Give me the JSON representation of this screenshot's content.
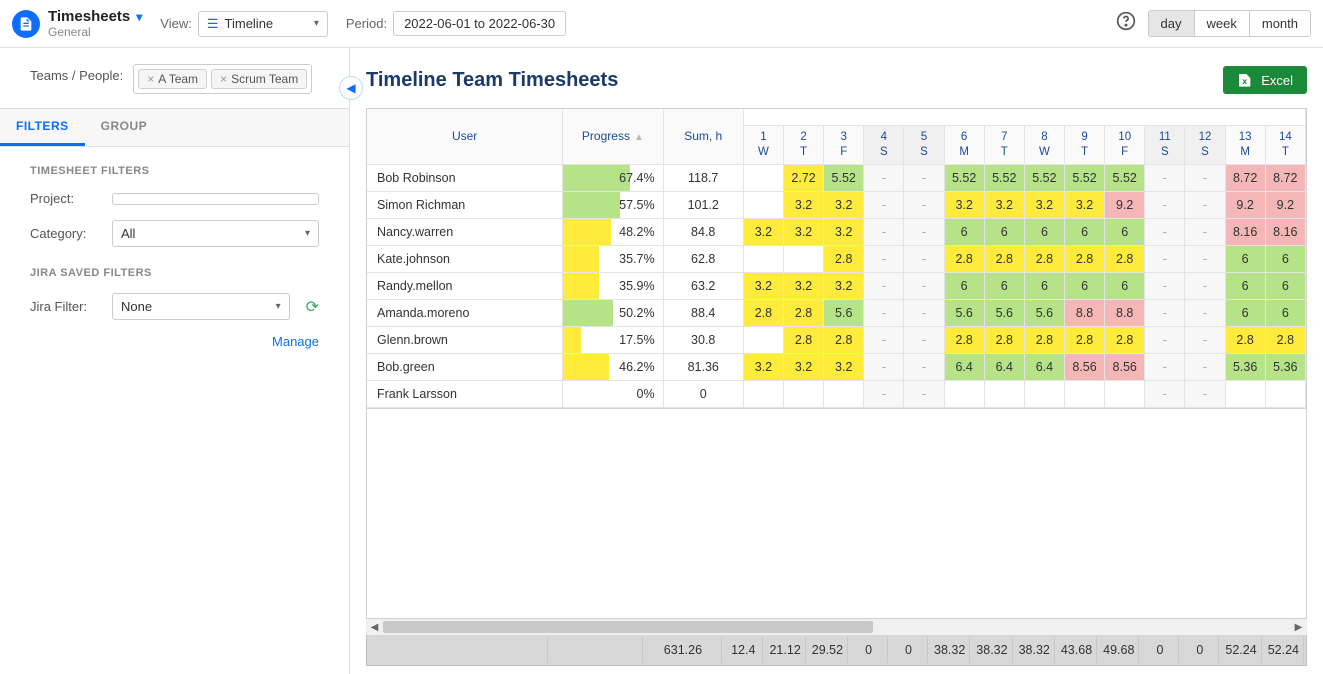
{
  "header": {
    "title": "Timesheets",
    "subtitle": "General",
    "view_label": "View:",
    "view_value": "Timeline",
    "period_label": "Period:",
    "period_value": "2022-06-01 to 2022-06-30",
    "ranges": {
      "day": "day",
      "week": "week",
      "month": "month"
    }
  },
  "sidebar": {
    "teams_label": "Teams / People:",
    "chip1": "A Team",
    "chip2": "Scrum Team",
    "tab_filters": "FILTERS",
    "tab_group": "GROUP",
    "sect_timesheet": "TIMESHEET FILTERS",
    "project_label": "Project:",
    "category_label": "Category:",
    "category_value": "All",
    "sect_jira": "JIRA SAVED FILTERS",
    "jira_label": "Jira Filter:",
    "jira_value": "None",
    "manage": "Manage"
  },
  "main": {
    "title": "Timeline Team Timesheets",
    "excel": "Excel"
  },
  "cols": {
    "user": "User",
    "progress": "Progress",
    "sum": "Sum, h",
    "days": [
      {
        "n": "1",
        "d": "W",
        "we": false
      },
      {
        "n": "2",
        "d": "T",
        "we": false
      },
      {
        "n": "3",
        "d": "F",
        "we": false
      },
      {
        "n": "4",
        "d": "S",
        "we": true
      },
      {
        "n": "5",
        "d": "S",
        "we": true
      },
      {
        "n": "6",
        "d": "M",
        "we": false
      },
      {
        "n": "7",
        "d": "T",
        "we": false
      },
      {
        "n": "8",
        "d": "W",
        "we": false
      },
      {
        "n": "9",
        "d": "T",
        "we": false
      },
      {
        "n": "10",
        "d": "F",
        "we": false
      },
      {
        "n": "11",
        "d": "S",
        "we": true
      },
      {
        "n": "12",
        "d": "S",
        "we": true
      },
      {
        "n": "13",
        "d": "M",
        "we": false
      },
      {
        "n": "14",
        "d": "T",
        "we": false
      }
    ]
  },
  "rows": [
    {
      "user": "Bob Robinson",
      "progress": "67.4%",
      "pw": 67.4,
      "pb": "green",
      "sum": "118.7",
      "cells": [
        {
          "v": "",
          "c": ""
        },
        {
          "v": "2.72",
          "c": "c-yellow"
        },
        {
          "v": "5.52",
          "c": "c-green"
        },
        {
          "v": "-",
          "c": "dash weekend"
        },
        {
          "v": "-",
          "c": "dash weekend"
        },
        {
          "v": "5.52",
          "c": "c-green"
        },
        {
          "v": "5.52",
          "c": "c-green"
        },
        {
          "v": "5.52",
          "c": "c-green"
        },
        {
          "v": "5.52",
          "c": "c-green"
        },
        {
          "v": "5.52",
          "c": "c-green"
        },
        {
          "v": "-",
          "c": "dash weekend"
        },
        {
          "v": "-",
          "c": "dash weekend"
        },
        {
          "v": "8.72",
          "c": "c-red"
        },
        {
          "v": "8.72",
          "c": "c-red"
        }
      ]
    },
    {
      "user": "Simon Richman",
      "progress": "57.5%",
      "pw": 57.5,
      "pb": "green",
      "sum": "101.2",
      "cells": [
        {
          "v": "",
          "c": ""
        },
        {
          "v": "3.2",
          "c": "c-yellow"
        },
        {
          "v": "3.2",
          "c": "c-yellow"
        },
        {
          "v": "-",
          "c": "dash weekend"
        },
        {
          "v": "-",
          "c": "dash weekend"
        },
        {
          "v": "3.2",
          "c": "c-yellow"
        },
        {
          "v": "3.2",
          "c": "c-yellow"
        },
        {
          "v": "3.2",
          "c": "c-yellow"
        },
        {
          "v": "3.2",
          "c": "c-yellow"
        },
        {
          "v": "9.2",
          "c": "c-red"
        },
        {
          "v": "-",
          "c": "dash weekend"
        },
        {
          "v": "-",
          "c": "dash weekend"
        },
        {
          "v": "9.2",
          "c": "c-red"
        },
        {
          "v": "9.2",
          "c": "c-red"
        }
      ]
    },
    {
      "user": "Nancy.warren",
      "progress": "48.2%",
      "pw": 48.2,
      "pb": "yellow",
      "sum": "84.8",
      "cells": [
        {
          "v": "3.2",
          "c": "c-yellow"
        },
        {
          "v": "3.2",
          "c": "c-yellow"
        },
        {
          "v": "3.2",
          "c": "c-yellow"
        },
        {
          "v": "-",
          "c": "dash weekend"
        },
        {
          "v": "-",
          "c": "dash weekend"
        },
        {
          "v": "6",
          "c": "c-green"
        },
        {
          "v": "6",
          "c": "c-green"
        },
        {
          "v": "6",
          "c": "c-green"
        },
        {
          "v": "6",
          "c": "c-green"
        },
        {
          "v": "6",
          "c": "c-green"
        },
        {
          "v": "-",
          "c": "dash weekend"
        },
        {
          "v": "-",
          "c": "dash weekend"
        },
        {
          "v": "8.16",
          "c": "c-red"
        },
        {
          "v": "8.16",
          "c": "c-red"
        }
      ]
    },
    {
      "user": "Kate.johnson",
      "progress": "35.7%",
      "pw": 35.7,
      "pb": "yellow",
      "sum": "62.8",
      "cells": [
        {
          "v": "",
          "c": ""
        },
        {
          "v": "",
          "c": ""
        },
        {
          "v": "2.8",
          "c": "c-yellow"
        },
        {
          "v": "-",
          "c": "dash weekend"
        },
        {
          "v": "-",
          "c": "dash weekend"
        },
        {
          "v": "2.8",
          "c": "c-yellow"
        },
        {
          "v": "2.8",
          "c": "c-yellow"
        },
        {
          "v": "2.8",
          "c": "c-yellow"
        },
        {
          "v": "2.8",
          "c": "c-yellow"
        },
        {
          "v": "2.8",
          "c": "c-yellow"
        },
        {
          "v": "-",
          "c": "dash weekend"
        },
        {
          "v": "-",
          "c": "dash weekend"
        },
        {
          "v": "6",
          "c": "c-green"
        },
        {
          "v": "6",
          "c": "c-green"
        }
      ]
    },
    {
      "user": "Randy.mellon",
      "progress": "35.9%",
      "pw": 35.9,
      "pb": "yellow",
      "sum": "63.2",
      "cells": [
        {
          "v": "3.2",
          "c": "c-yellow"
        },
        {
          "v": "3.2",
          "c": "c-yellow"
        },
        {
          "v": "3.2",
          "c": "c-yellow"
        },
        {
          "v": "-",
          "c": "dash weekend"
        },
        {
          "v": "-",
          "c": "dash weekend"
        },
        {
          "v": "6",
          "c": "c-green"
        },
        {
          "v": "6",
          "c": "c-green"
        },
        {
          "v": "6",
          "c": "c-green"
        },
        {
          "v": "6",
          "c": "c-green"
        },
        {
          "v": "6",
          "c": "c-green"
        },
        {
          "v": "-",
          "c": "dash weekend"
        },
        {
          "v": "-",
          "c": "dash weekend"
        },
        {
          "v": "6",
          "c": "c-green"
        },
        {
          "v": "6",
          "c": "c-green"
        }
      ]
    },
    {
      "user": "Amanda.moreno",
      "progress": "50.2%",
      "pw": 50.2,
      "pb": "green",
      "sum": "88.4",
      "cells": [
        {
          "v": "2.8",
          "c": "c-yellow"
        },
        {
          "v": "2.8",
          "c": "c-yellow"
        },
        {
          "v": "5.6",
          "c": "c-green"
        },
        {
          "v": "-",
          "c": "dash weekend"
        },
        {
          "v": "-",
          "c": "dash weekend"
        },
        {
          "v": "5.6",
          "c": "c-green"
        },
        {
          "v": "5.6",
          "c": "c-green"
        },
        {
          "v": "5.6",
          "c": "c-green"
        },
        {
          "v": "8.8",
          "c": "c-red"
        },
        {
          "v": "8.8",
          "c": "c-red"
        },
        {
          "v": "-",
          "c": "dash weekend"
        },
        {
          "v": "-",
          "c": "dash weekend"
        },
        {
          "v": "6",
          "c": "c-green"
        },
        {
          "v": "6",
          "c": "c-green"
        }
      ]
    },
    {
      "user": "Glenn.brown",
      "progress": "17.5%",
      "pw": 17.5,
      "pb": "yellow",
      "sum": "30.8",
      "cells": [
        {
          "v": "",
          "c": ""
        },
        {
          "v": "2.8",
          "c": "c-yellow"
        },
        {
          "v": "2.8",
          "c": "c-yellow"
        },
        {
          "v": "-",
          "c": "dash weekend"
        },
        {
          "v": "-",
          "c": "dash weekend"
        },
        {
          "v": "2.8",
          "c": "c-yellow"
        },
        {
          "v": "2.8",
          "c": "c-yellow"
        },
        {
          "v": "2.8",
          "c": "c-yellow"
        },
        {
          "v": "2.8",
          "c": "c-yellow"
        },
        {
          "v": "2.8",
          "c": "c-yellow"
        },
        {
          "v": "-",
          "c": "dash weekend"
        },
        {
          "v": "-",
          "c": "dash weekend"
        },
        {
          "v": "2.8",
          "c": "c-yellow"
        },
        {
          "v": "2.8",
          "c": "c-yellow"
        }
      ]
    },
    {
      "user": "Bob.green",
      "progress": "46.2%",
      "pw": 46.2,
      "pb": "yellow",
      "sum": "81.36",
      "cells": [
        {
          "v": "3.2",
          "c": "c-yellow"
        },
        {
          "v": "3.2",
          "c": "c-yellow"
        },
        {
          "v": "3.2",
          "c": "c-yellow"
        },
        {
          "v": "-",
          "c": "dash weekend"
        },
        {
          "v": "-",
          "c": "dash weekend"
        },
        {
          "v": "6.4",
          "c": "c-green"
        },
        {
          "v": "6.4",
          "c": "c-green"
        },
        {
          "v": "6.4",
          "c": "c-green"
        },
        {
          "v": "8.56",
          "c": "c-red"
        },
        {
          "v": "8.56",
          "c": "c-red"
        },
        {
          "v": "-",
          "c": "dash weekend"
        },
        {
          "v": "-",
          "c": "dash weekend"
        },
        {
          "v": "5.36",
          "c": "c-green"
        },
        {
          "v": "5.36",
          "c": "c-green"
        }
      ]
    },
    {
      "user": "Frank Larsson",
      "progress": "0%",
      "pw": 0,
      "pb": "yellow",
      "sum": "0",
      "cells": [
        {
          "v": "",
          "c": ""
        },
        {
          "v": "",
          "c": ""
        },
        {
          "v": "",
          "c": ""
        },
        {
          "v": "-",
          "c": "dash weekend"
        },
        {
          "v": "-",
          "c": "dash weekend"
        },
        {
          "v": "",
          "c": ""
        },
        {
          "v": "",
          "c": ""
        },
        {
          "v": "",
          "c": ""
        },
        {
          "v": "",
          "c": ""
        },
        {
          "v": "",
          "c": ""
        },
        {
          "v": "-",
          "c": "dash weekend"
        },
        {
          "v": "-",
          "c": "dash weekend"
        },
        {
          "v": "",
          "c": ""
        },
        {
          "v": "",
          "c": ""
        }
      ]
    }
  ],
  "totals": [
    "",
    "",
    "631.26",
    "12.4",
    "21.12",
    "29.52",
    "0",
    "0",
    "38.32",
    "38.32",
    "38.32",
    "43.68",
    "49.68",
    "0",
    "0",
    "52.24",
    "52.24"
  ]
}
